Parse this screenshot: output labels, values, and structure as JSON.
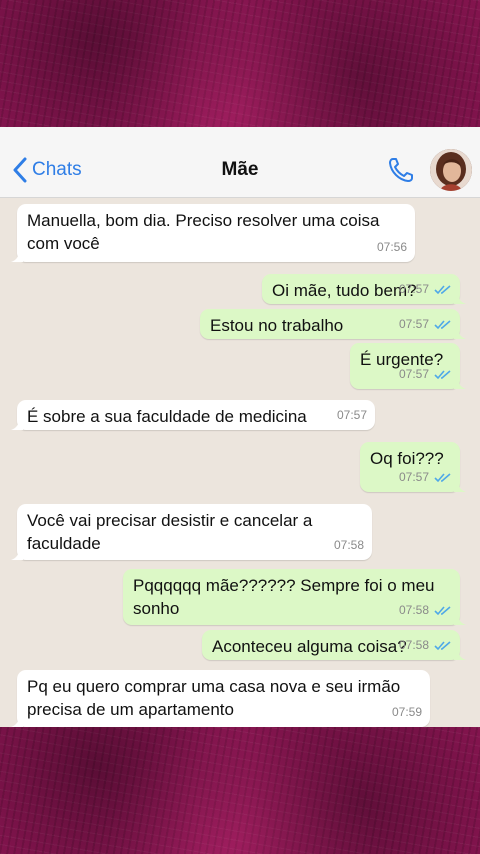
{
  "header": {
    "back_label": "Chats",
    "contact_name": "Mãe"
  },
  "messages": [
    {
      "text": "Manuella, bom dia. Preciso resolver uma coisa com você",
      "time": "07:56",
      "dir": "in"
    },
    {
      "text": "Oi mãe, tudo bem?",
      "time": "07:57",
      "dir": "out"
    },
    {
      "text": "Estou no trabalho",
      "time": "07:57",
      "dir": "out"
    },
    {
      "text": "É urgente?",
      "time": "07:57",
      "dir": "out"
    },
    {
      "text": "É sobre a sua faculdade de medicina",
      "time": "07:57",
      "dir": "in"
    },
    {
      "text": "Oq foi???",
      "time": "07:57",
      "dir": "out"
    },
    {
      "text": "Você vai precisar desistir e cancelar a faculdade",
      "time": "07:58",
      "dir": "in"
    },
    {
      "text": "Pqqqqqq mãe?????? Sempre foi o meu sonho",
      "time": "07:58",
      "dir": "out"
    },
    {
      "text": "Aconteceu alguma coisa?",
      "time": "07:58",
      "dir": "out"
    },
    {
      "text": "Pq eu quero comprar uma casa nova e seu irmão precisa de um apartamento",
      "time": "07:59",
      "dir": "in"
    }
  ],
  "colors": {
    "accent": "#2f7ee6",
    "outgoing_bubble": "#dcf8c6",
    "incoming_bubble": "#ffffff",
    "chat_background": "#ece5dd",
    "read_ticks": "#4fa8e8",
    "frame": "#8a1552"
  },
  "icons": [
    "chevron-left-icon",
    "phone-icon",
    "avatar",
    "double-check-icon"
  ]
}
